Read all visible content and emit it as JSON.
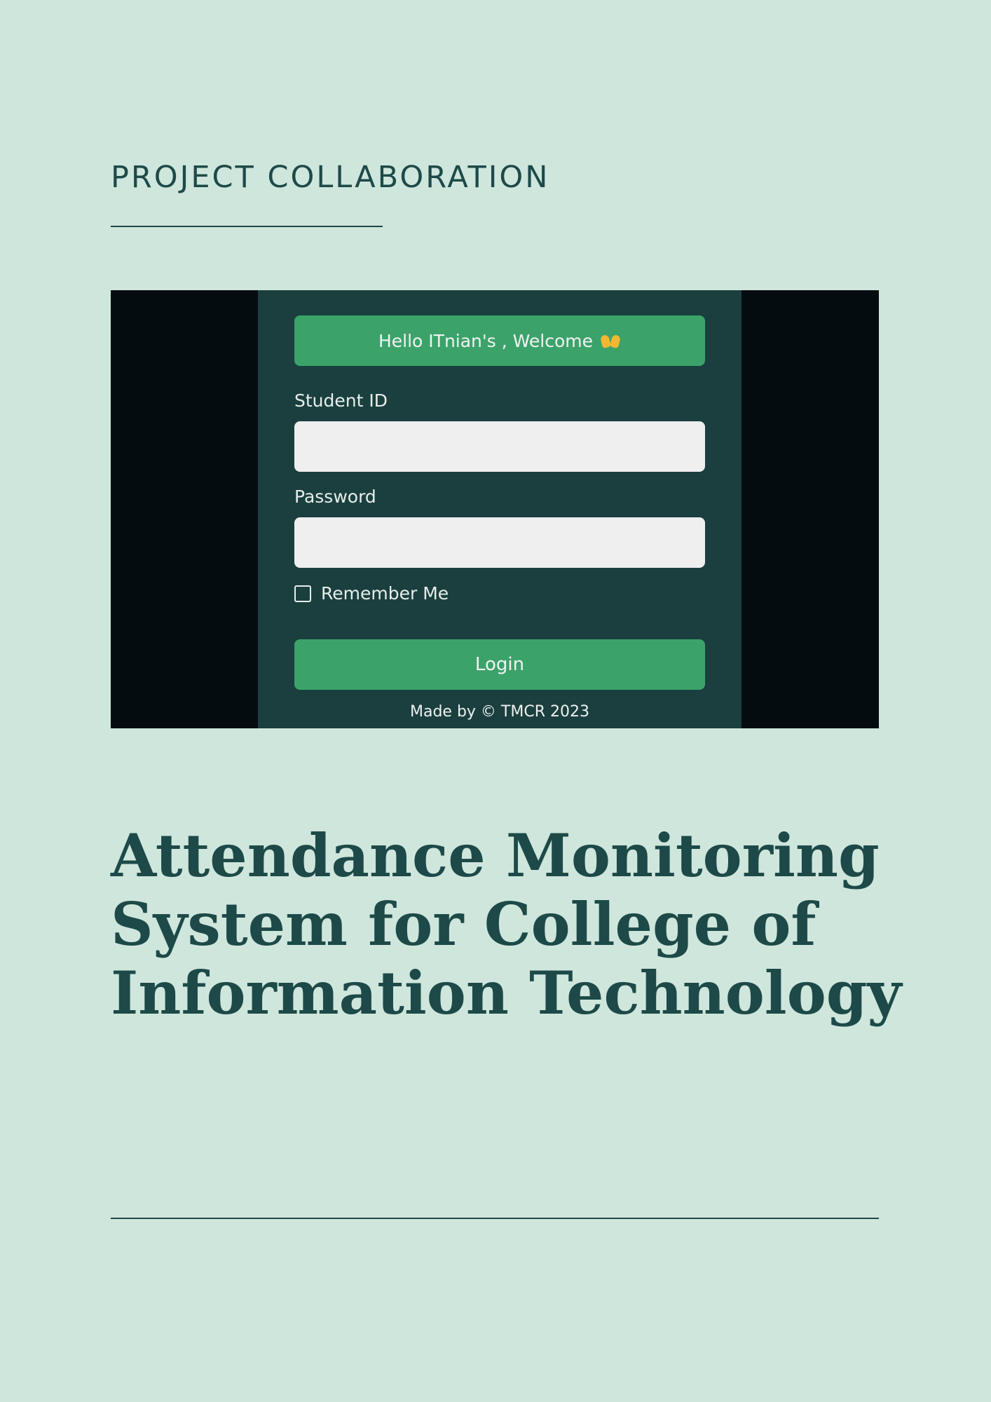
{
  "header": {
    "eyebrow": "PROJECT  COLLABORATION"
  },
  "login_screenshot": {
    "welcome_text": "Hello ITnian's , Welcome",
    "welcome_icon": "raising-hands-icon",
    "student_id_label": "Student ID",
    "student_id_value": "",
    "password_label": "Password",
    "password_value": "",
    "remember_label": "Remember Me",
    "login_label": "Login",
    "credit": "Made by © TMCR 2023"
  },
  "title": {
    "lines": [
      "Attendance Monitoring",
      "System for College of",
      "Information Technology"
    ]
  },
  "colors": {
    "page_background": "#cfe6dc",
    "heading": "#1d4a48",
    "panel": "#1a3f3e",
    "accent_green": "#3ba36a",
    "outer_dark": "#050c10"
  }
}
